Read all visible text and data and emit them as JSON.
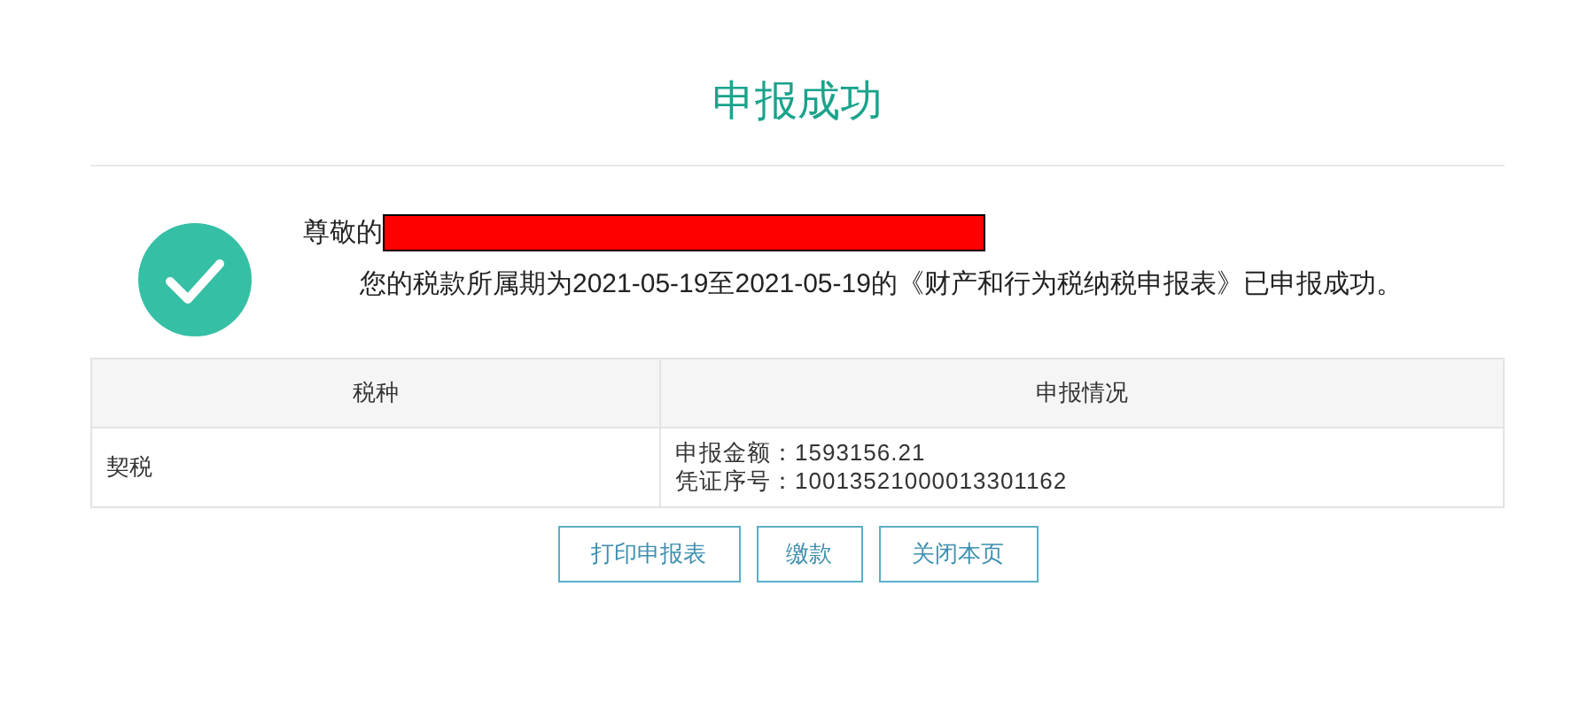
{
  "title": "申报成功",
  "greeting": "尊敬的",
  "message": "您的税款所属期为2021-05-19至2021-05-19的《财产和行为税纳税申报表》已申报成功。",
  "table": {
    "columns": [
      "税种",
      "申报情况"
    ],
    "rows": [
      {
        "tax_type": "契税",
        "details": [
          "申报金额：1593156.21",
          "凭证序号：10013521000013301162"
        ]
      }
    ]
  },
  "buttons": [
    "打印申报表",
    "缴款",
    "关闭本页"
  ]
}
